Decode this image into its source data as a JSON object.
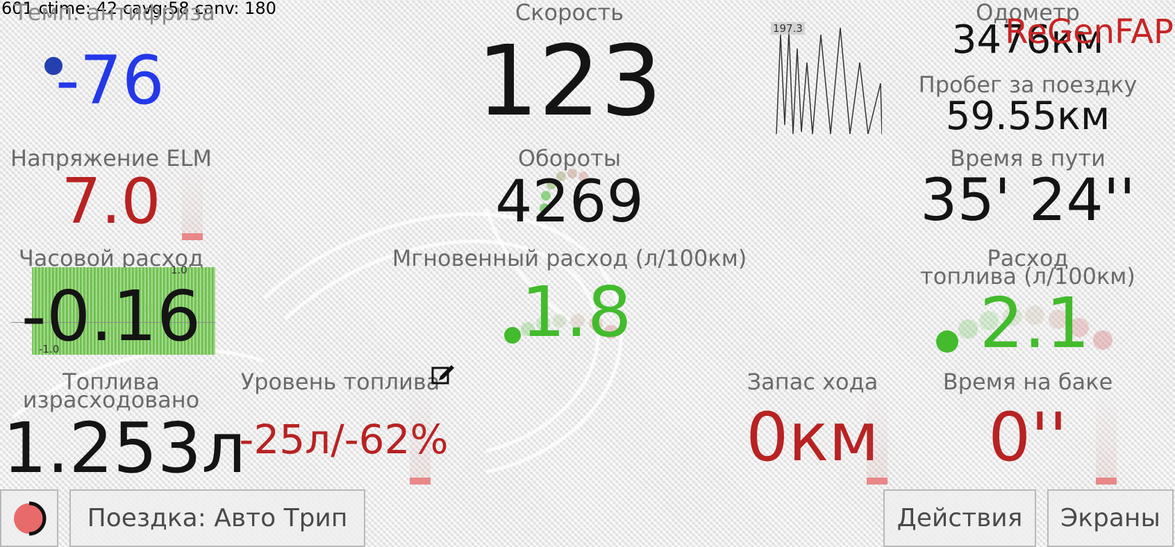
{
  "debug_text": "601 ctime: 42 cavg:58 canv: 180",
  "coolant": {
    "label": "Темп. антифриза",
    "value": "-76"
  },
  "speed": {
    "label": "Скорость",
    "value": "123",
    "sparkline_max": "197.3"
  },
  "odometer": {
    "label": "Одометр",
    "value": "3476км",
    "overlay": "ReGenFAP"
  },
  "trip_distance": {
    "label": "Пробег за поездку",
    "value": "59.55км"
  },
  "elm_voltage": {
    "label": "Напряжение ELM",
    "value": "7.0"
  },
  "rpm": {
    "label": "Обороты",
    "value": "4269"
  },
  "trip_time": {
    "label": "Время в пути",
    "value": "35' 24''"
  },
  "hourly_consumption": {
    "label": "Часовой расход",
    "value": "-0.16",
    "graph_max": "1.0",
    "graph_min": "-1.0"
  },
  "instant_consumption": {
    "label": "Мгновенный расход (л/100км)",
    "value": "1.8"
  },
  "avg_consumption": {
    "label_line1": "Расход",
    "label_line2": "топлива (л/100км)",
    "value": "2.1"
  },
  "fuel_used": {
    "label_line1": "Топлива",
    "label_line2": "израсходовано",
    "value": "1.253л"
  },
  "fuel_level": {
    "label": "Уровень топлива",
    "value": "-25л/-62%"
  },
  "range": {
    "label": "Запас хода",
    "value": "0км"
  },
  "time_on_tank": {
    "label": "Время на баке",
    "value": "0''"
  },
  "buttons": {
    "trip": "Поездка: Авто Трип",
    "actions": "Действия",
    "screens": "Экраны"
  },
  "colors": {
    "cold_blue": "#2438e8",
    "warn_red": "#b82222",
    "good_green": "#43bb2d",
    "record_red": "#e86a6a"
  }
}
